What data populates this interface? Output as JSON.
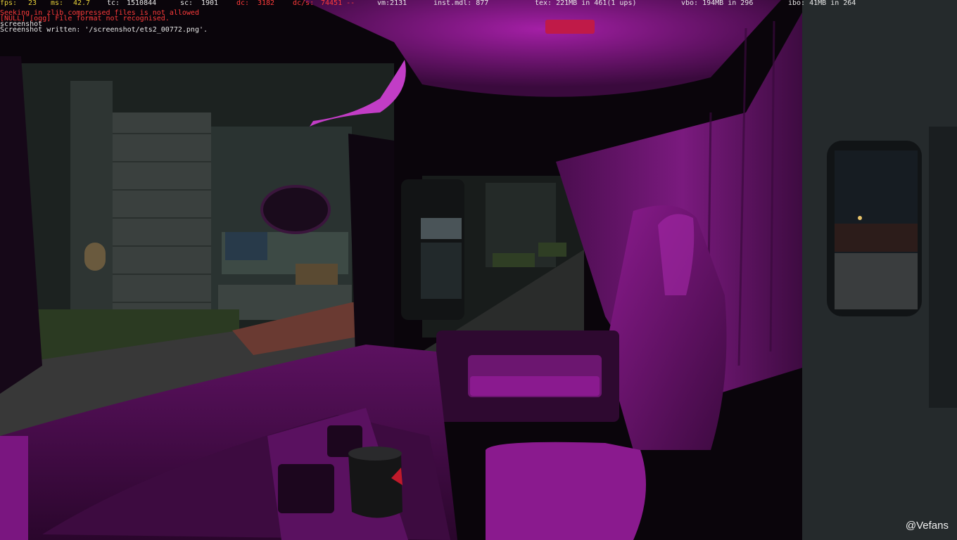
{
  "hud": {
    "fps_label": "fps:",
    "fps_value": "23",
    "ms_label": "ms:",
    "ms_value": "42.7",
    "tc_label": "tc:",
    "tc_value": "1510844",
    "sc_label": "sc:",
    "sc_value": "1901",
    "dc_label": "dc:",
    "dc_value": "3182",
    "dcs_label": "dc/s:",
    "dcs_value": "74451 --",
    "vm": "vm:2131",
    "inst": "inst.mdl: 877",
    "tex": "tex: 221MB in 461(1 ups)",
    "vbo": "vbo: 194MB in 296",
    "ibo": "ibo: 41MB in 264"
  },
  "console": {
    "lines": [
      "Seeking in zlib compressed files is not allowed",
      "[NULL] [ogg] File format not recognised.",
      "screenshot",
      "Screenshot written: '/screenshot/ets2_00772.png'."
    ]
  },
  "watermark": "@Vefans",
  "colors": {
    "interior": "#8a1a8f",
    "hud_yellow": "#e8d23a",
    "hud_red": "#ff3b3b"
  }
}
